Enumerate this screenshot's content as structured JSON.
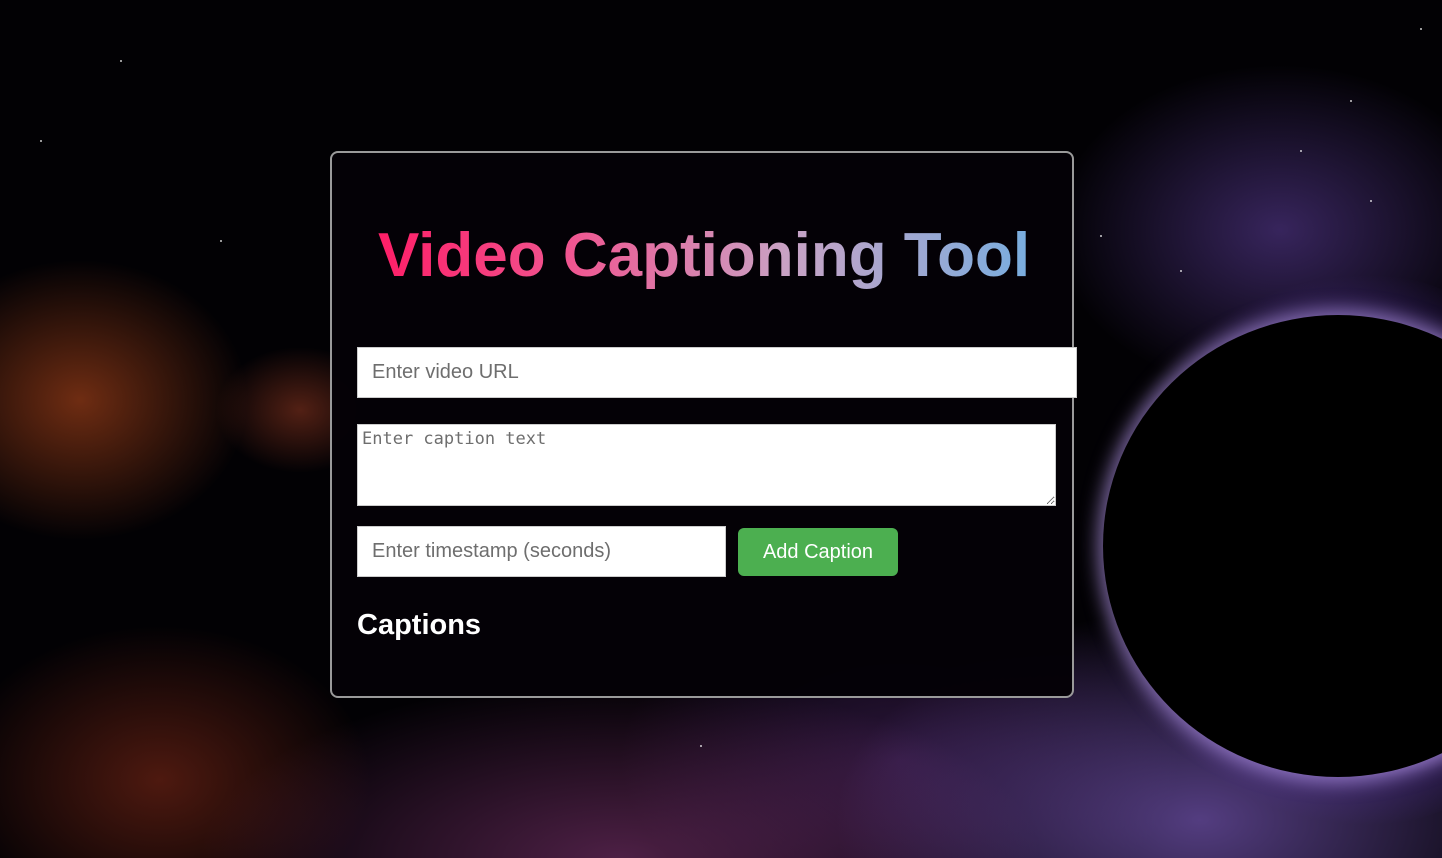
{
  "app": {
    "title": "Video Captioning Tool"
  },
  "form": {
    "video_url_placeholder": "Enter video URL",
    "video_url_value": "",
    "caption_placeholder": "Enter caption text",
    "caption_value": "",
    "timestamp_placeholder": "Enter timestamp (seconds)",
    "timestamp_value": "",
    "add_button_label": "Add Caption"
  },
  "captions": {
    "heading": "Captions",
    "items": []
  },
  "colors": {
    "button_bg": "#4caf50",
    "title_gradient_start": "#ff1a64",
    "title_gradient_end": "#74aee0",
    "card_border": "#9a9a9a"
  }
}
